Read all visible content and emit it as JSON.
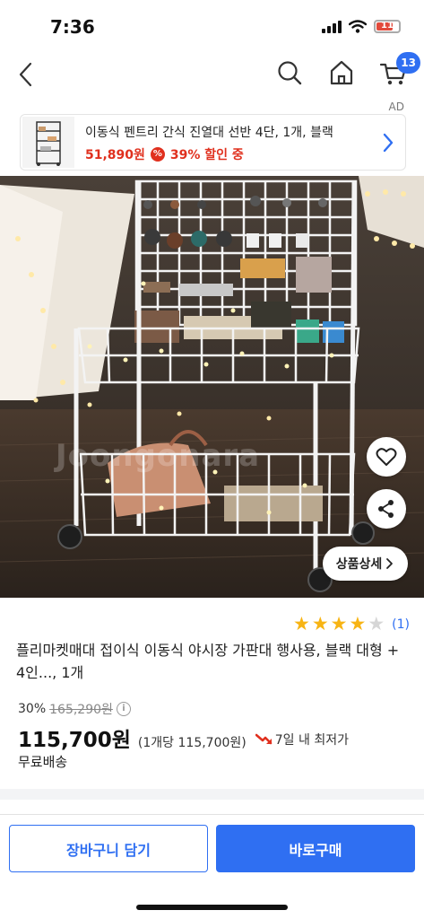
{
  "status_bar": {
    "time": "7:36",
    "battery_text": "11",
    "icons": [
      "signal-icon",
      "wifi-icon",
      "battery-icon"
    ]
  },
  "nav": {
    "icons": [
      "back-arrow-icon",
      "search-icon",
      "home-icon",
      "cart-icon"
    ],
    "cart_badge": "13"
  },
  "ad": {
    "label": "AD",
    "title": "이동식 펜트리 간식 진열대 선반 4단, 1개, 블랙",
    "price": "51,890원",
    "discount": "39% 할인 중",
    "discount_icon": "%"
  },
  "product_image": {
    "watermark": "Joongonara",
    "detail_button": "상품상세",
    "icons": [
      "heart-icon",
      "share-icon",
      "chevron-right-icon"
    ]
  },
  "product": {
    "rating": 4,
    "rating_max": 5,
    "rating_count": "(1)",
    "title": "플리마켓매대 접이식 이동식 야시장 가판대 행사용, 블랙 대형 + 4인..., 1개",
    "discount_percent": "30%",
    "original_price": "165,290원",
    "price": "115,700원",
    "unit_price": "(1개당 115,700원)",
    "lowest_price_text": "7일 내 최저가",
    "shipping": "무료배송"
  },
  "actions": {
    "cart_button": "장바구니 담기",
    "buy_button": "바로구매"
  },
  "colors": {
    "accent": "#2f6ff2",
    "sale_red": "#e0301e",
    "star": "#f7b414"
  }
}
